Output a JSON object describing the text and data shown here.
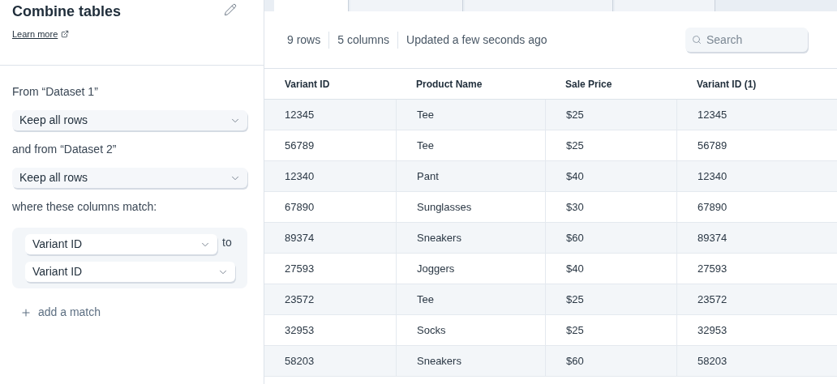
{
  "panel": {
    "title": "Combine tables",
    "learn_more": "Learn more",
    "from_1_label": "From “Dataset 1”",
    "from_1_value": "Keep all rows",
    "from_2_label": "and from “Dataset 2”",
    "from_2_value": "Keep all rows",
    "match_label": "where these columns match:",
    "matches": [
      {
        "left": "Variant ID",
        "joiner": "to",
        "right": "Variant ID"
      }
    ],
    "add_match": "add a match"
  },
  "tabs": [
    {
      "selected": true
    },
    {
      "selected": false
    },
    {
      "selected": false
    },
    {
      "selected": false
    }
  ],
  "summary": {
    "rows": "9 rows",
    "columns": "5 columns",
    "updated": "Updated a few seconds ago"
  },
  "search": {
    "placeholder": "Search"
  },
  "table": {
    "columns": [
      "Variant ID",
      "Product Name",
      "Sale Price",
      "Variant ID (1)"
    ],
    "rows": [
      [
        "12345",
        "Tee",
        "$25",
        "12345"
      ],
      [
        "56789",
        "Tee",
        "$25",
        "56789"
      ],
      [
        "12340",
        "Pant",
        "$40",
        "12340"
      ],
      [
        "67890",
        "Sunglasses",
        "$30",
        "67890"
      ],
      [
        "89374",
        "Sneakers",
        "$60",
        "89374"
      ],
      [
        "27593",
        "Joggers",
        "$40",
        "27593"
      ],
      [
        "23572",
        "Tee",
        "$25",
        "23572"
      ],
      [
        "32953",
        "Socks",
        "$25",
        "32953"
      ],
      [
        "58203",
        "Sneakers",
        "$60",
        "58203"
      ]
    ]
  }
}
